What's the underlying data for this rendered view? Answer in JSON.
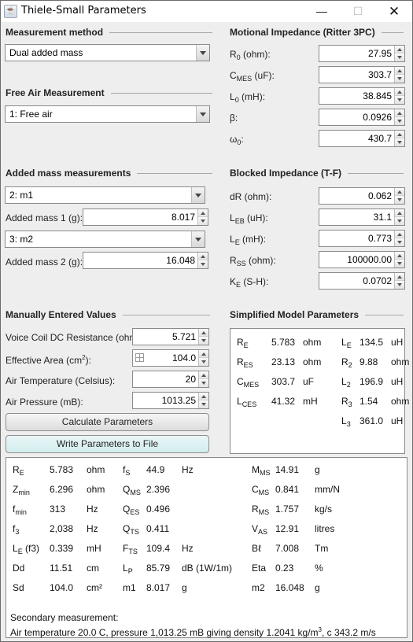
{
  "window": {
    "title": "Thiele-Small Parameters",
    "app_icon": "java-cup-icon",
    "controls": {
      "minimize": "—",
      "maximize": "☐",
      "close": "✕"
    }
  },
  "measurement_method": {
    "title": "Measurement method",
    "selected": "Dual added mass"
  },
  "free_air": {
    "title": "Free Air Measurement",
    "selected": "1: Free air"
  },
  "added_mass": {
    "title": "Added mass measurements",
    "m1_selected": "2: m1",
    "m1_label": "Added mass 1 (g):",
    "m1_value": "8.017",
    "m2_selected": "3: m2",
    "m2_label": "Added mass 2 (g):",
    "m2_value": "16.048"
  },
  "motional": {
    "title": "Motional Impedance (Ritter 3PC)",
    "fields": [
      {
        "sym": "R",
        "sub": "0",
        "unit": " (ohm):",
        "value": "27.95"
      },
      {
        "sym": "C",
        "sub": "MES",
        "unit": " (uF):",
        "value": "303.7"
      },
      {
        "sym": "L",
        "sub": "0",
        "unit": " (mH):",
        "value": "38.845"
      },
      {
        "sym": "β",
        "sub": "",
        "unit": ":",
        "value": "0.0926"
      },
      {
        "sym": "ω",
        "sub": "0",
        "unit": ":",
        "value": "430.7"
      }
    ]
  },
  "blocked": {
    "title": "Blocked Impedance (T-F)",
    "fields": [
      {
        "sym": "dR",
        "sub": "",
        "unit": " (ohm):",
        "value": "0.062"
      },
      {
        "sym": "L",
        "sub": "EB",
        "unit": " (uH):",
        "value": "31.1"
      },
      {
        "sym": "L",
        "sub": "E",
        "unit": " (mH):",
        "value": "0.773"
      },
      {
        "sym": "R",
        "sub": "SS",
        "unit": " (ohm):",
        "value": "100000.00"
      },
      {
        "sym": "K",
        "sub": "E",
        "unit": " (S-H):",
        "value": "0.0702"
      }
    ]
  },
  "manual": {
    "title": "Manually Entered Values",
    "voice_coil_label": "Voice Coil DC Resistance (ohm):",
    "voice_coil_value": "5.721",
    "area_label_pre": "Effective Area (cm",
    "area_label_sup": "2",
    "area_label_post": "):",
    "area_value": "104.0",
    "temp_label": "Air Temperature (Celsius):",
    "temp_value": "20",
    "pressure_label": "Air Pressure (mB):",
    "pressure_value": "1013.25",
    "calculate_button": "Calculate Parameters",
    "write_button": "Write Parameters to File"
  },
  "simplified": {
    "title": "Simplified Model Parameters",
    "left": [
      {
        "sym": "R",
        "sub": "E",
        "value": "5.783",
        "unit": "ohm"
      },
      {
        "sym": "R",
        "sub": "ES",
        "value": "23.13",
        "unit": "ohm"
      },
      {
        "sym": "C",
        "sub": "MES",
        "value": "303.7",
        "unit": "uF"
      },
      {
        "sym": "L",
        "sub": "CES",
        "value": "41.32",
        "unit": "mH"
      }
    ],
    "right": [
      {
        "sym": "L",
        "sub": "E",
        "value": "134.5",
        "unit": "uH"
      },
      {
        "sym": "R",
        "sub": "2",
        "value": "9.88",
        "unit": "ohm"
      },
      {
        "sym": "L",
        "sub": "2",
        "value": "196.9",
        "unit": "uH"
      },
      {
        "sym": "R",
        "sub": "3",
        "value": "1.54",
        "unit": "ohm"
      },
      {
        "sym": "L",
        "sub": "3",
        "value": "361.0",
        "unit": "uH"
      }
    ]
  },
  "results": {
    "col1": [
      {
        "sym": "R",
        "sub": "E",
        "extra": "",
        "value": "5.783",
        "unit": "ohm"
      },
      {
        "sym": "Z",
        "sub": "min",
        "extra": "",
        "value": "6.296",
        "unit": "ohm"
      },
      {
        "sym": "f",
        "sub": "min",
        "extra": "",
        "value": "313",
        "unit": "Hz"
      },
      {
        "sym": "f",
        "sub": "3",
        "extra": "",
        "value": "2,038",
        "unit": "Hz"
      },
      {
        "sym": "L",
        "sub": "E",
        "extra": " (f3)",
        "value": "0.339",
        "unit": "mH"
      },
      {
        "sym": "Dd",
        "sub": "",
        "extra": "",
        "value": "11.51",
        "unit": "cm"
      },
      {
        "sym": "Sd",
        "sub": "",
        "extra": "",
        "value": "104.0",
        "unit": "cm²"
      }
    ],
    "col2": [
      {
        "sym": "f",
        "sub": "S",
        "value": "44.9",
        "unit": "Hz"
      },
      {
        "sym": "Q",
        "sub": "MS",
        "value": "2.396",
        "unit": ""
      },
      {
        "sym": "Q",
        "sub": "ES",
        "value": "0.496",
        "unit": ""
      },
      {
        "sym": "Q",
        "sub": "TS",
        "value": "0.411",
        "unit": ""
      },
      {
        "sym": "F",
        "sub": "TS",
        "value": "109.4",
        "unit": "Hz"
      },
      {
        "sym": "L",
        "sub": "P",
        "value": "85.79",
        "unit": "dB (1W/1m)"
      },
      {
        "sym": "m1",
        "sub": "",
        "value": "8.017",
        "unit": "g"
      }
    ],
    "col3": [
      {
        "sym": "M",
        "sub": "MS",
        "value": "14.91",
        "unit": "g"
      },
      {
        "sym": "C",
        "sub": "MS",
        "value": "0.841",
        "unit": "mm/N"
      },
      {
        "sym": "R",
        "sub": "MS",
        "value": "1.757",
        "unit": "kg/s"
      },
      {
        "sym": "V",
        "sub": "AS",
        "value": "12.91",
        "unit": "litres"
      },
      {
        "sym": "Bℓ",
        "sub": "",
        "value": "7.008",
        "unit": "Tm"
      },
      {
        "sym": "Eta",
        "sub": "",
        "value": "0.23",
        "unit": "%"
      },
      {
        "sym": "m2",
        "sub": "",
        "value": "16.048",
        "unit": "g"
      }
    ],
    "secondary_label": "Secondary measurement:",
    "secondary_text_pre": "Air temperature 20.0 C, pressure 1,013.25 mB giving density 1.2041 kg/m",
    "secondary_text_sup": "3",
    "secondary_text_post": ", c 343.2 m/s"
  }
}
